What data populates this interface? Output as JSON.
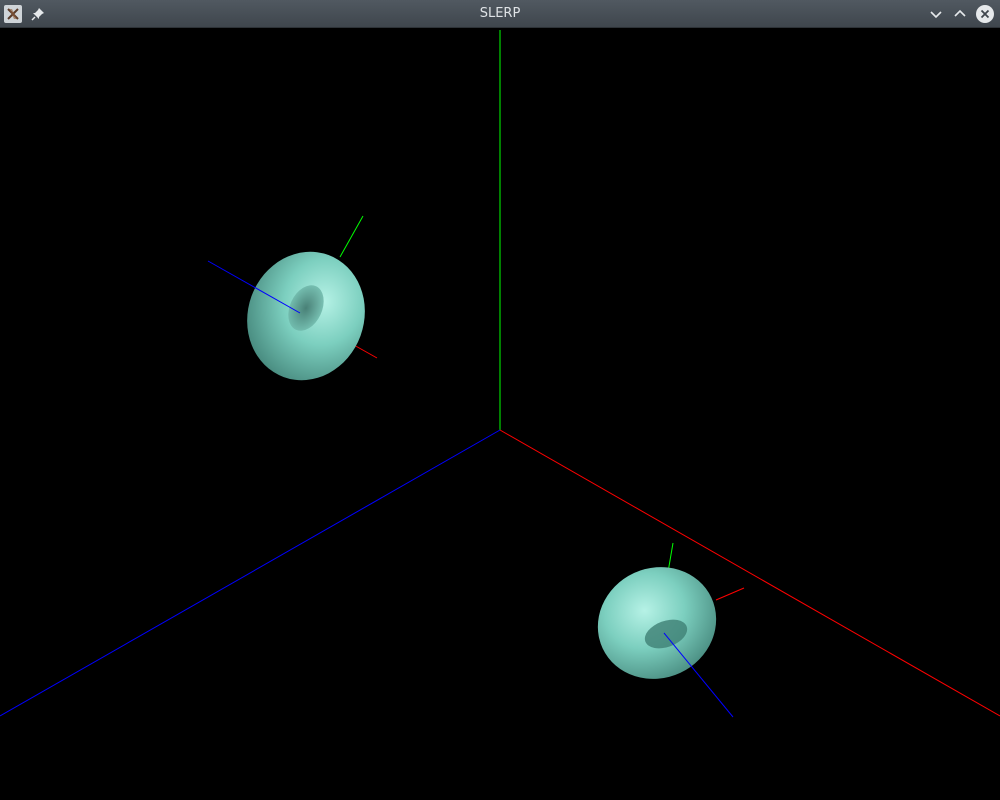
{
  "window": {
    "title": "SLERP",
    "icons": {
      "app": "x-app-icon",
      "pin": "pin-icon",
      "minimize": "chevron-down-icon",
      "maximize": "chevron-up-icon",
      "close": "close-icon"
    }
  },
  "scene": {
    "background": "#000000",
    "axis_colors": {
      "x": "#ff0000",
      "y": "#00ff00",
      "z": "#0000ff"
    },
    "torus_color": "#7ccfbf",
    "objects": [
      "torus-start",
      "torus-end"
    ]
  }
}
